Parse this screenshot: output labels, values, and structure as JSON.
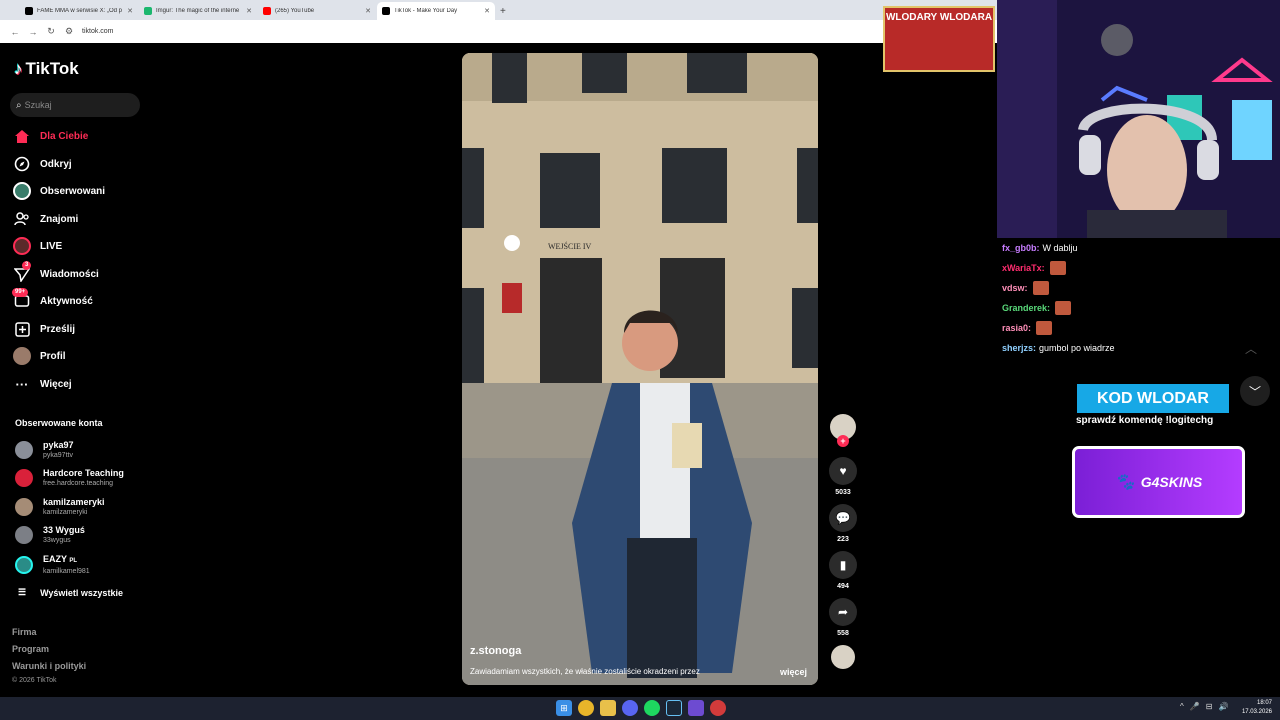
{
  "browser": {
    "tabs": [
      {
        "title": "FAME MMA w serwisie X: „Od p",
        "icon": "x-logo-icon",
        "color": "#000000"
      },
      {
        "title": "Imgur: The magic of the interne",
        "icon": "imgur-icon",
        "color": "#1bb76e"
      },
      {
        "title": "(265) YouTube",
        "icon": "youtube-icon",
        "color": "#ff0000"
      },
      {
        "title": "TikTok - Make Your Day",
        "icon": "tiktok-icon",
        "color": "#000000"
      }
    ],
    "url": "tiktok.com"
  },
  "sidebar": {
    "logo": "TikTok",
    "search_placeholder": "Szukaj",
    "nav": [
      {
        "label": "Dla Ciebie",
        "icon": "home-icon",
        "active": true
      },
      {
        "label": "Odkryj",
        "icon": "compass-icon"
      },
      {
        "label": "Obserwowani",
        "icon": "following-avatar-icon"
      },
      {
        "label": "Znajomi",
        "icon": "friends-icon"
      },
      {
        "label": "LIVE",
        "icon": "live-icon"
      },
      {
        "label": "Wiadomości",
        "icon": "send-icon",
        "badge": "3"
      },
      {
        "label": "Aktywność",
        "icon": "inbox-icon",
        "badge": "99+"
      },
      {
        "label": "Prześlij",
        "icon": "upload-icon"
      },
      {
        "label": "Profil",
        "icon": "profile-icon"
      },
      {
        "label": "Więcej",
        "icon": "more-icon"
      }
    ],
    "following_title": "Obserwowane konta",
    "accounts": [
      {
        "name": "pyka97",
        "handle": "pyka97ttv",
        "color": "#8a8f99"
      },
      {
        "name": "Hardcore Teaching",
        "handle": "free.hardcore.teaching",
        "color": "#d9213a"
      },
      {
        "name": "kamilzameryki",
        "handle": "kamilzameryki",
        "color": "#a58c76"
      },
      {
        "name": "33 Wyguś",
        "handle": "33wygus",
        "color": "#7c7f86"
      },
      {
        "name": "EAZY",
        "handle": "kamilkamel981",
        "color": "#2a8c87",
        "badge": "PL"
      }
    ],
    "show_all": "Wyświetl wszystkie",
    "footer": [
      "Firma",
      "Program",
      "Warunki i polityki"
    ],
    "copyright": "© 2026 TikTok"
  },
  "video": {
    "author": "z.stonoga",
    "description": "Zawiadamiam wszystkich, że właśnie zostaliście okradzeni  przez",
    "more": "więcej",
    "sign": "WEJŚCIE IV",
    "likes": "5033",
    "comments": "223",
    "saves": "494",
    "shares": "558"
  },
  "overlay": {
    "banner": "WLODARY WLODARA",
    "chat": [
      {
        "user": "fx_gb0b:",
        "text": "W dablju",
        "color": "#c77dff"
      },
      {
        "user": "xWariaTx:",
        "text": "",
        "color": "#ff2d6f",
        "emote": true
      },
      {
        "user": "vdsw:",
        "text": "",
        "color": "#ff8fb8",
        "emote": true
      },
      {
        "user": "Granderek:",
        "text": "",
        "color": "#59d97a",
        "emote": true
      },
      {
        "user": "rasia0:",
        "text": "",
        "color": "#ff8fb8",
        "emote": true
      },
      {
        "user": "sherjzs:",
        "text": "gumbol po wiadrze",
        "color": "#8fd0ff"
      }
    ],
    "kod_label": "KOD WLODAR",
    "kod_sub": "sprawdź komendę !logitechg",
    "g4": "G4SKINS"
  },
  "taskbar": {
    "time": "18:07",
    "date": "17.03.2026"
  }
}
